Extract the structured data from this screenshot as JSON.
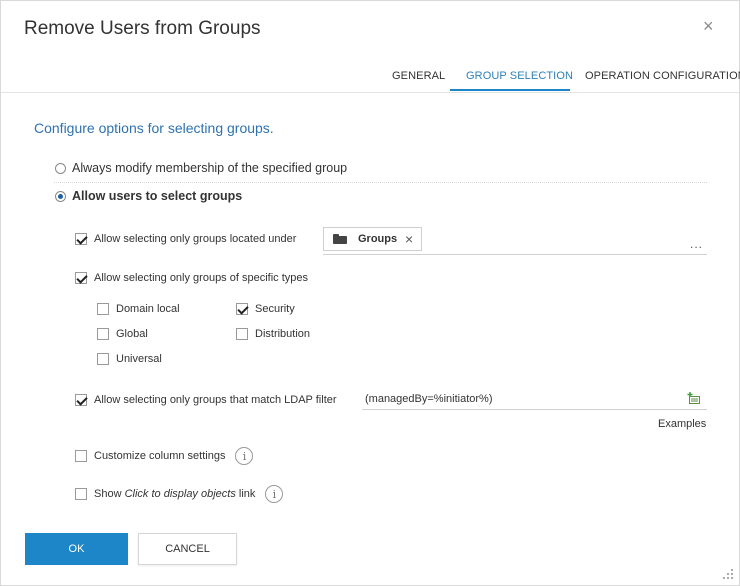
{
  "dialog": {
    "title": "Remove Users from Groups",
    "close_symbol": "×"
  },
  "tabs": [
    {
      "label": "GENERAL"
    },
    {
      "label": "GROUP SELECTION",
      "active": true
    },
    {
      "label": "OPERATION CONFIGURATION"
    }
  ],
  "content": {
    "section_title": "Configure options for selecting groups.",
    "radio_always": "Always modify membership of the specified group",
    "radio_allow": "Allow users to select groups",
    "located_under_label": "Allow selecting only groups located under",
    "chip_label": "Groups",
    "chip_remove": "×",
    "browse_ellipsis": "...",
    "specific_types_label": "Allow selecting only groups of specific types",
    "types": {
      "domain_local": "Domain local",
      "security": "Security",
      "global": "Global",
      "distribution": "Distribution",
      "universal": "Universal"
    },
    "ldap_label": "Allow selecting only groups that match LDAP filter",
    "ldap_value": "(managedBy=%initiator%)",
    "examples_link": "Examples",
    "customize_columns_label": "Customize column settings",
    "show_link_prefix": "Show ",
    "show_link_italic": "Click to display objects",
    "show_link_suffix": " link",
    "info_symbol": "i"
  },
  "footer": {
    "ok_label": "OK",
    "cancel_label": "CANCEL"
  },
  "colors": {
    "accent": "#1c86c8",
    "section_title": "#2e72b0"
  }
}
